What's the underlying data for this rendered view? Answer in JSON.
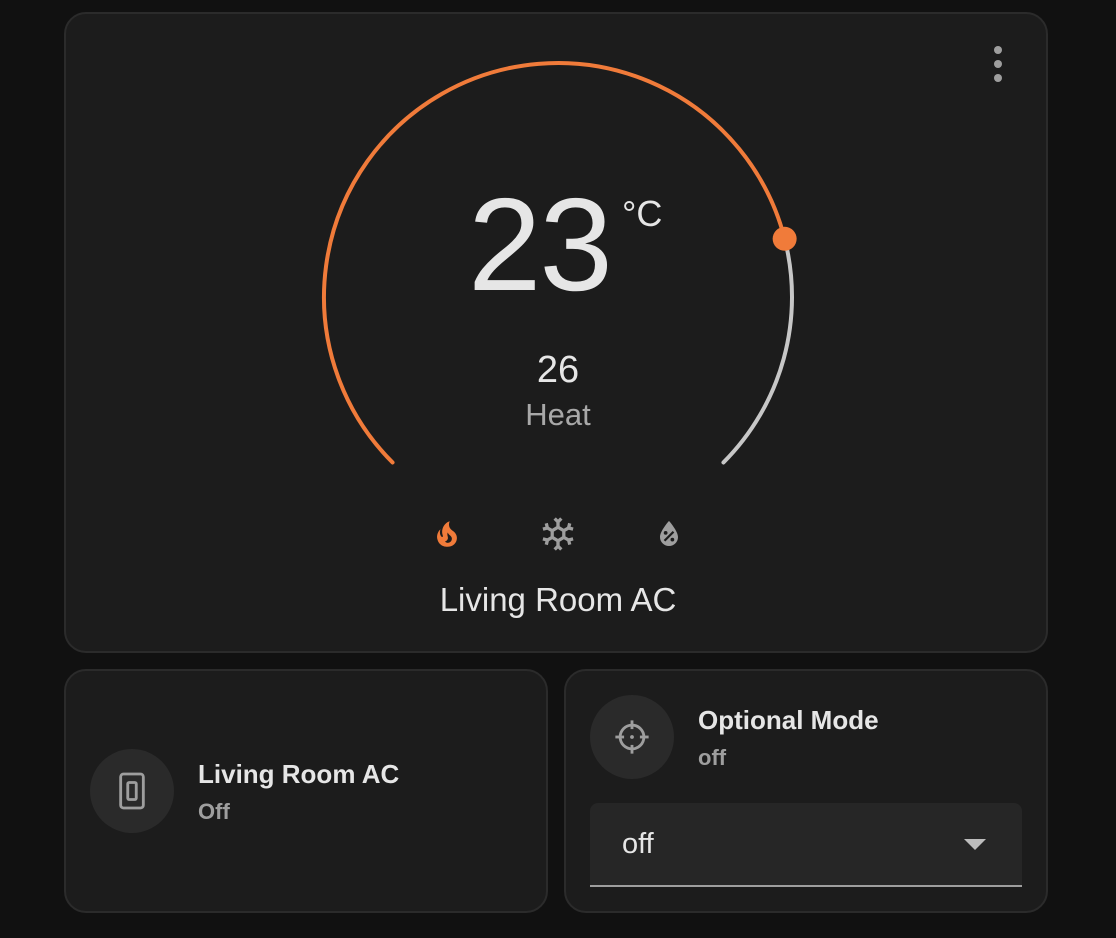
{
  "thermostat": {
    "target_temperature": "23",
    "unit": "°C",
    "current_temperature": "26",
    "hvac_action": "Heat",
    "name": "Living Room AC",
    "target_fraction": 0.78,
    "modes": [
      {
        "name": "heat",
        "icon": "fire-icon",
        "active": true
      },
      {
        "name": "cool",
        "icon": "snowflake-icon",
        "active": false
      },
      {
        "name": "dry",
        "icon": "water-percent-icon",
        "active": false
      }
    ],
    "menu_icon": "dots-vertical-icon"
  },
  "switch_tile": {
    "name": "Living Room AC",
    "state": "Off",
    "icon": "light-switch-icon"
  },
  "select_tile": {
    "name": "Optional Mode",
    "state": "off",
    "icon": "crosshairs-icon",
    "selected_option": "off"
  },
  "colors": {
    "accent": "#f07b3a",
    "track": "#c7c7c7",
    "card": "#1c1c1c",
    "background": "#111111"
  }
}
